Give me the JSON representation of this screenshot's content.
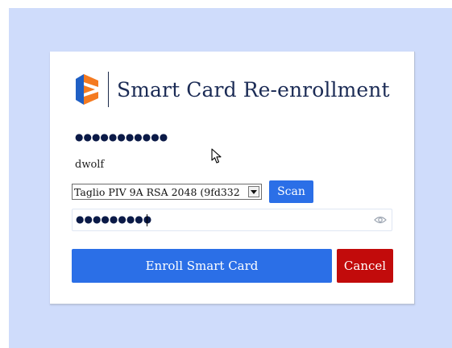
{
  "dialog": {
    "title": "Smart Card Re-enrollment",
    "masked_user_value": "●●●●●●●●●●●",
    "username": "dwolf",
    "card_select": {
      "selected": "Taglio PIV 9A RSA 2048 (9fd332"
    },
    "scan_label": "Scan",
    "pin_field": {
      "masked_value": "●●●●●●●●●"
    },
    "enroll_label": "Enroll Smart Card",
    "cancel_label": "Cancel"
  },
  "icons": {
    "logo": "company-logo-icon",
    "eye": "eye-icon",
    "dropdown": "chevron-down-icon",
    "cursor": "mouse-cursor-icon"
  },
  "colors": {
    "backdrop": "#cfdcfb",
    "primary": "#2b6fe7",
    "danger": "#c20b0b",
    "title": "#1b2b55",
    "logo_blue": "#1f5fc4",
    "logo_orange": "#f47a20"
  }
}
